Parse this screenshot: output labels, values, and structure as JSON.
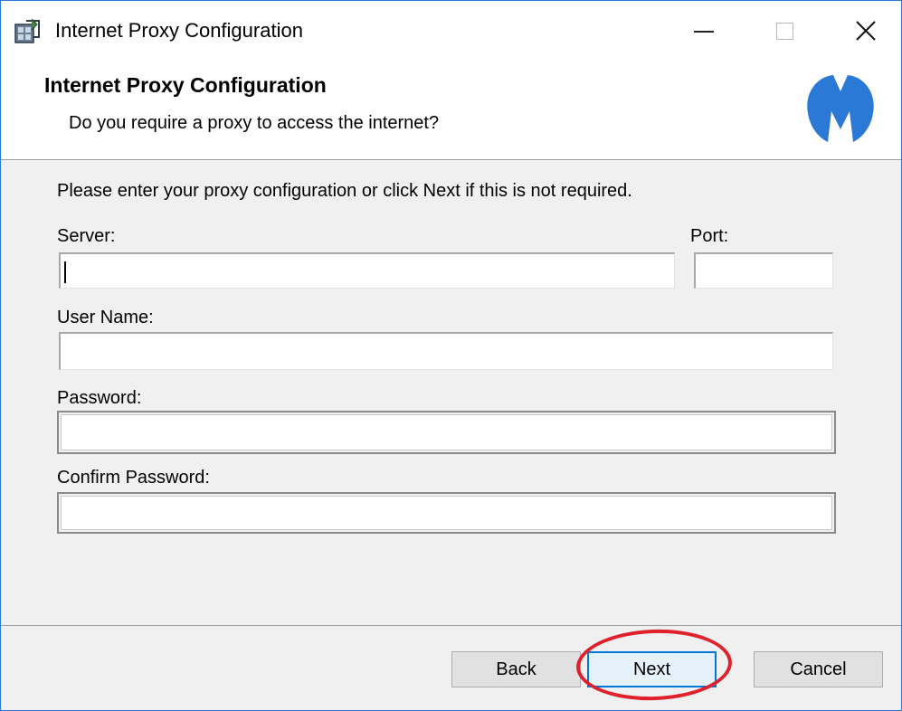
{
  "window": {
    "title": "Internet Proxy Configuration",
    "app_icon": "installer-icon",
    "controls": [
      "minimize-icon",
      "maximize-icon",
      "close-icon"
    ]
  },
  "banner": {
    "title": "Internet Proxy Configuration",
    "subtitle": "Do you require a proxy to access the internet?",
    "logo": "malwarebytes-logo",
    "logo_color": "#2a79d6"
  },
  "form": {
    "instructions": "Please enter your proxy configuration or click Next if this is not required.",
    "server": {
      "label": "Server:",
      "value": ""
    },
    "port": {
      "label": "Port:",
      "value": ""
    },
    "username": {
      "label": "User Name:",
      "value": ""
    },
    "password": {
      "label": "Password:",
      "value": ""
    },
    "confirm_password": {
      "label": "Confirm Password:",
      "value": ""
    }
  },
  "footer": {
    "back_label": "Back",
    "next_label": "Next",
    "cancel_label": "Cancel",
    "highlight_color": "#e0202a",
    "focus_color": "#0078d7"
  }
}
